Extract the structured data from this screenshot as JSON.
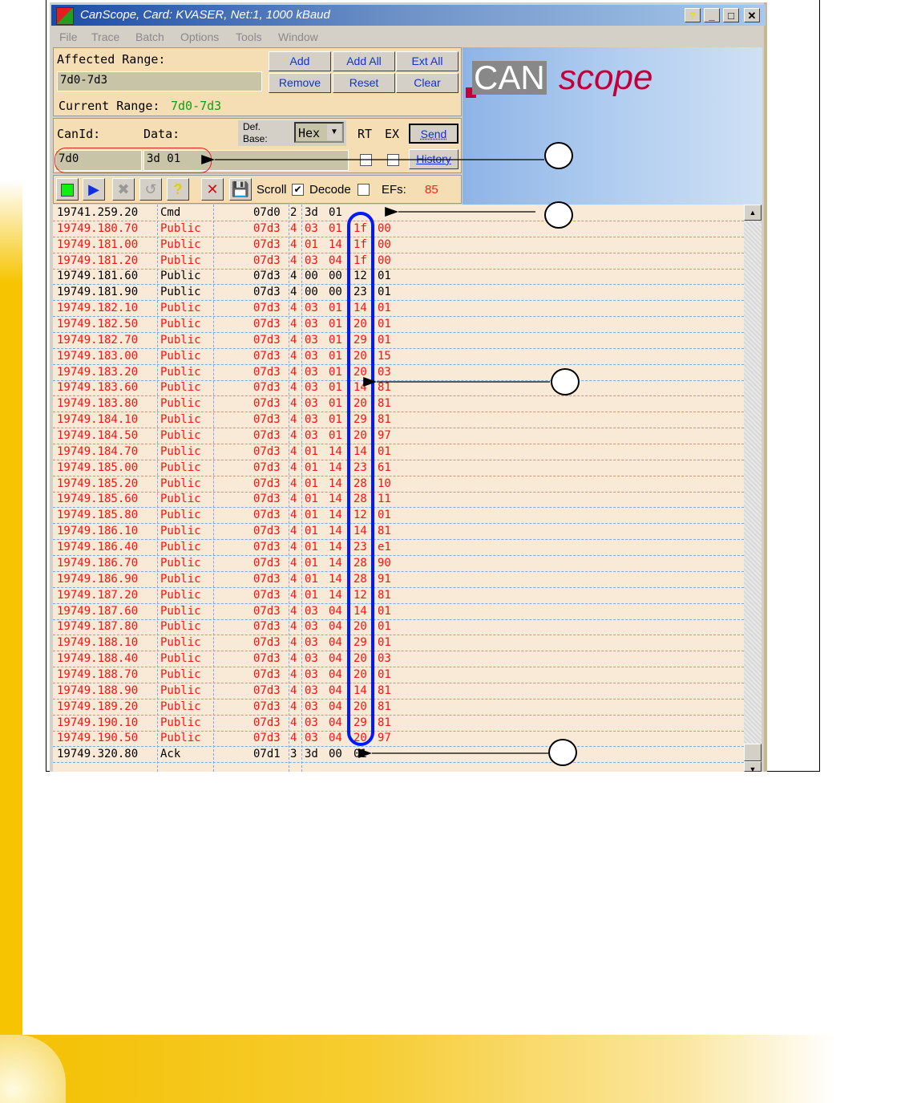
{
  "window": {
    "title": "CanScope, Card: KVASER, Net:1, 1000 kBaud",
    "help": "?",
    "minimize": "_",
    "maximize": "□",
    "close": "✕"
  },
  "menu": [
    "File",
    "Trace",
    "Batch",
    "Options",
    "Tools",
    "Window"
  ],
  "range": {
    "affected_label": "Affected Range:",
    "affected_value": "7d0-7d3",
    "current_label": "Current Range:",
    "current_value": "7d0-7d3",
    "buttons": {
      "add": "Add",
      "add_all": "Add All",
      "ext_all": "Ext All",
      "remove": "Remove",
      "reset": "Reset",
      "clear": "Clear"
    }
  },
  "send": {
    "canid_label": "CanId:",
    "data_label": "Data:",
    "defbase_label1": "Def.",
    "defbase_label2": "Base:",
    "base_value": "Hex",
    "rt_label": "RT",
    "ex_label": "EX",
    "send_button": "Send",
    "history_button": "History",
    "canid_value": "7d0",
    "data_value": "3d 01"
  },
  "toolbar": {
    "scroll_label": "Scroll",
    "scroll_checked": true,
    "decode_label": "Decode",
    "decode_checked": false,
    "efs_label": "EFs:",
    "efs_value": "85"
  },
  "logo": {
    "can": "CAN",
    "scope": "scope"
  },
  "colors": {
    "red": "#ff1010",
    "black": "#000000",
    "highlight": "#0018ff"
  },
  "trace": [
    {
      "time": "19741.259.20",
      "type": "Cmd",
      "id": "07d0",
      "dlc": "2",
      "d": [
        "3d",
        "01",
        "",
        ""
      ],
      "color": "black"
    },
    {
      "time": "19749.180.70",
      "type": "Public",
      "id": "07d3",
      "dlc": "4",
      "d": [
        "03",
        "01",
        "1f",
        "00"
      ],
      "color": "red"
    },
    {
      "time": "19749.181.00",
      "type": "Public",
      "id": "07d3",
      "dlc": "4",
      "d": [
        "01",
        "14",
        "1f",
        "00"
      ],
      "color": "red"
    },
    {
      "time": "19749.181.20",
      "type": "Public",
      "id": "07d3",
      "dlc": "4",
      "d": [
        "03",
        "04",
        "1f",
        "00"
      ],
      "color": "red"
    },
    {
      "time": "19749.181.60",
      "type": "Public",
      "id": "07d3",
      "dlc": "4",
      "d": [
        "00",
        "00",
        "12",
        "01"
      ],
      "color": "black"
    },
    {
      "time": "19749.181.90",
      "type": "Public",
      "id": "07d3",
      "dlc": "4",
      "d": [
        "00",
        "00",
        "23",
        "01"
      ],
      "color": "black"
    },
    {
      "time": "19749.182.10",
      "type": "Public",
      "id": "07d3",
      "dlc": "4",
      "d": [
        "03",
        "01",
        "14",
        "01"
      ],
      "color": "red"
    },
    {
      "time": "19749.182.50",
      "type": "Public",
      "id": "07d3",
      "dlc": "4",
      "d": [
        "03",
        "01",
        "20",
        "01"
      ],
      "color": "red"
    },
    {
      "time": "19749.182.70",
      "type": "Public",
      "id": "07d3",
      "dlc": "4",
      "d": [
        "03",
        "01",
        "29",
        "01"
      ],
      "color": "red"
    },
    {
      "time": "19749.183.00",
      "type": "Public",
      "id": "07d3",
      "dlc": "4",
      "d": [
        "03",
        "01",
        "20",
        "15"
      ],
      "color": "red"
    },
    {
      "time": "19749.183.20",
      "type": "Public",
      "id": "07d3",
      "dlc": "4",
      "d": [
        "03",
        "01",
        "20",
        "03"
      ],
      "color": "red"
    },
    {
      "time": "19749.183.60",
      "type": "Public",
      "id": "07d3",
      "dlc": "4",
      "d": [
        "03",
        "01",
        "14",
        "81"
      ],
      "color": "red"
    },
    {
      "time": "19749.183.80",
      "type": "Public",
      "id": "07d3",
      "dlc": "4",
      "d": [
        "03",
        "01",
        "20",
        "81"
      ],
      "color": "red"
    },
    {
      "time": "19749.184.10",
      "type": "Public",
      "id": "07d3",
      "dlc": "4",
      "d": [
        "03",
        "01",
        "29",
        "81"
      ],
      "color": "red"
    },
    {
      "time": "19749.184.50",
      "type": "Public",
      "id": "07d3",
      "dlc": "4",
      "d": [
        "03",
        "01",
        "20",
        "97"
      ],
      "color": "red"
    },
    {
      "time": "19749.184.70",
      "type": "Public",
      "id": "07d3",
      "dlc": "4",
      "d": [
        "01",
        "14",
        "14",
        "01"
      ],
      "color": "red"
    },
    {
      "time": "19749.185.00",
      "type": "Public",
      "id": "07d3",
      "dlc": "4",
      "d": [
        "01",
        "14",
        "23",
        "61"
      ],
      "color": "red"
    },
    {
      "time": "19749.185.20",
      "type": "Public",
      "id": "07d3",
      "dlc": "4",
      "d": [
        "01",
        "14",
        "28",
        "10"
      ],
      "color": "red"
    },
    {
      "time": "19749.185.60",
      "type": "Public",
      "id": "07d3",
      "dlc": "4",
      "d": [
        "01",
        "14",
        "28",
        "11"
      ],
      "color": "red"
    },
    {
      "time": "19749.185.80",
      "type": "Public",
      "id": "07d3",
      "dlc": "4",
      "d": [
        "01",
        "14",
        "12",
        "01"
      ],
      "color": "red"
    },
    {
      "time": "19749.186.10",
      "type": "Public",
      "id": "07d3",
      "dlc": "4",
      "d": [
        "01",
        "14",
        "14",
        "81"
      ],
      "color": "red"
    },
    {
      "time": "19749.186.40",
      "type": "Public",
      "id": "07d3",
      "dlc": "4",
      "d": [
        "01",
        "14",
        "23",
        "e1"
      ],
      "color": "red"
    },
    {
      "time": "19749.186.70",
      "type": "Public",
      "id": "07d3",
      "dlc": "4",
      "d": [
        "01",
        "14",
        "28",
        "90"
      ],
      "color": "red"
    },
    {
      "time": "19749.186.90",
      "type": "Public",
      "id": "07d3",
      "dlc": "4",
      "d": [
        "01",
        "14",
        "28",
        "91"
      ],
      "color": "red"
    },
    {
      "time": "19749.187.20",
      "type": "Public",
      "id": "07d3",
      "dlc": "4",
      "d": [
        "01",
        "14",
        "12",
        "81"
      ],
      "color": "red"
    },
    {
      "time": "19749.187.60",
      "type": "Public",
      "id": "07d3",
      "dlc": "4",
      "d": [
        "03",
        "04",
        "14",
        "01"
      ],
      "color": "red"
    },
    {
      "time": "19749.187.80",
      "type": "Public",
      "id": "07d3",
      "dlc": "4",
      "d": [
        "03",
        "04",
        "20",
        "01"
      ],
      "color": "red"
    },
    {
      "time": "19749.188.10",
      "type": "Public",
      "id": "07d3",
      "dlc": "4",
      "d": [
        "03",
        "04",
        "29",
        "01"
      ],
      "color": "red"
    },
    {
      "time": "19749.188.40",
      "type": "Public",
      "id": "07d3",
      "dlc": "4",
      "d": [
        "03",
        "04",
        "20",
        "03"
      ],
      "color": "red"
    },
    {
      "time": "19749.188.70",
      "type": "Public",
      "id": "07d3",
      "dlc": "4",
      "d": [
        "03",
        "04",
        "20",
        "01"
      ],
      "color": "red"
    },
    {
      "time": "19749.188.90",
      "type": "Public",
      "id": "07d3",
      "dlc": "4",
      "d": [
        "03",
        "04",
        "14",
        "81"
      ],
      "color": "red"
    },
    {
      "time": "19749.189.20",
      "type": "Public",
      "id": "07d3",
      "dlc": "4",
      "d": [
        "03",
        "04",
        "20",
        "81"
      ],
      "color": "red"
    },
    {
      "time": "19749.190.10",
      "type": "Public",
      "id": "07d3",
      "dlc": "4",
      "d": [
        "03",
        "04",
        "29",
        "81"
      ],
      "color": "red"
    },
    {
      "time": "19749.190.50",
      "type": "Public",
      "id": "07d3",
      "dlc": "4",
      "d": [
        "03",
        "04",
        "20",
        "97"
      ],
      "color": "red"
    },
    {
      "time": "19749.320.80",
      "type": "Ack",
      "id": "07d1",
      "dlc": "3",
      "d": [
        "3d",
        "00",
        "01",
        ""
      ],
      "color": "black"
    }
  ]
}
